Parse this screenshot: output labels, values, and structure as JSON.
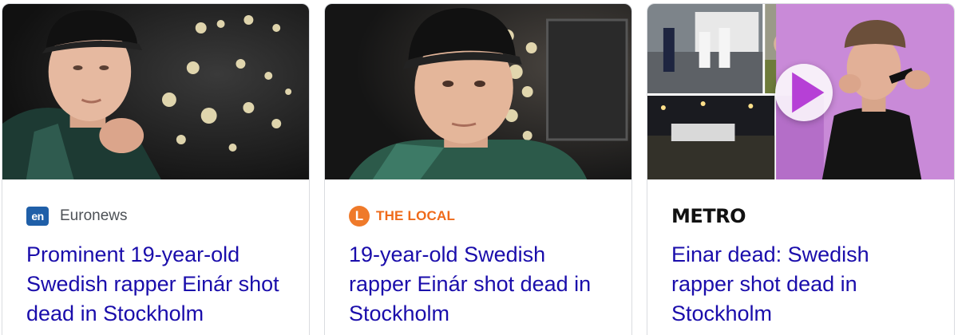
{
  "cards": [
    {
      "source": "Euronews",
      "logo_text": "en",
      "title": "Prominent 19-year-old Swedish rapper Einár shot dead in Stockholm"
    },
    {
      "source": "THE LOCAL",
      "logo_text": "L",
      "title": "19-year-old Swedish rapper Einár shot dead in Stockholm"
    },
    {
      "source": "METRO",
      "title": "Einar dead: Swedish rapper shot dead in Stockholm",
      "has_video": true
    }
  ],
  "colors": {
    "title_link": "#1a0dab",
    "source_text": "#4d5156",
    "euronews_brand": "#1f5fa8",
    "local_brand": "#ef6a1a",
    "play_icon": "#b640d6"
  }
}
